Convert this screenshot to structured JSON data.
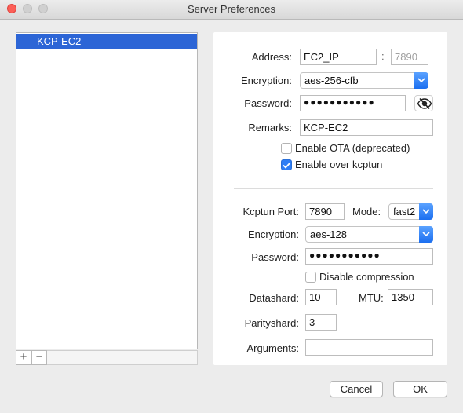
{
  "window": {
    "title": "Server Preferences"
  },
  "server_list": {
    "items": [
      "KCP-EC2"
    ],
    "add_label": "+",
    "remove_label": "−"
  },
  "server": {
    "address_label": "Address:",
    "address": "EC2_IP",
    "port_sep": ":",
    "port": "7890",
    "encryption_label": "Encryption:",
    "encryption": "aes-256-cfb",
    "password_label": "Password:",
    "password_masked": "●●●●●●●●●●●",
    "remarks_label": "Remarks:",
    "remarks": "KCP-EC2",
    "ota_label": "Enable OTA (deprecated)",
    "ota_checked": false,
    "kcptun_label": "Enable over kcptun",
    "kcptun_checked": true
  },
  "kcptun": {
    "port_label": "Kcptun Port:",
    "port": "7890",
    "mode_label": "Mode:",
    "mode": "fast2",
    "encryption_label": "Encryption:",
    "encryption": "aes-128",
    "password_label": "Password:",
    "password_masked": "●●●●●●●●●●●",
    "disable_compression_label": "Disable compression",
    "disable_compression_checked": false,
    "datashard_label": "Datashard:",
    "datashard": "10",
    "mtu_label": "MTU:",
    "mtu": "1350",
    "parityshard_label": "Parityshard:",
    "parityshard": "3",
    "arguments_label": "Arguments:",
    "arguments": ""
  },
  "buttons": {
    "cancel": "Cancel",
    "ok": "OK"
  },
  "colors": {
    "selection": "#2c65d6",
    "accent": "#2f7ef5",
    "close": "#fc5f57"
  },
  "icons": {
    "visibility_toggle": "eye-slash-icon",
    "select_arrow": "chevron-down-icon",
    "check": "checkmark-icon"
  }
}
